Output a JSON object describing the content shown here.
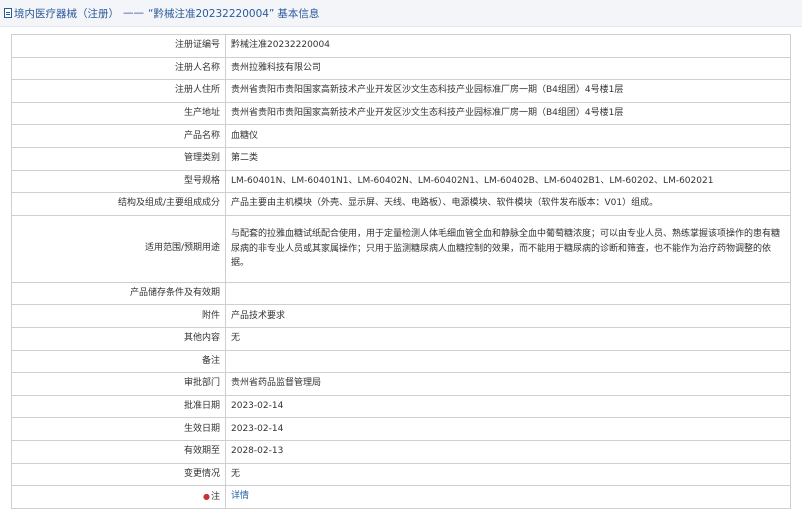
{
  "header": {
    "title": "境内医疗器械（注册）",
    "separator": "——",
    "subject": "“黔械注准20232220004”",
    "suffix": "基本信息"
  },
  "rows": [
    {
      "label": "注册证编号",
      "value": "黔械注准20232220004"
    },
    {
      "label": "注册人名称",
      "value": "贵州拉雅科技有限公司"
    },
    {
      "label": "注册人住所",
      "value": "贵州省贵阳市贵阳国家高新技术产业开发区沙文生态科技产业园标准厂房一期（B4组团）4号楼1层"
    },
    {
      "label": "生产地址",
      "value": "贵州省贵阳市贵阳国家高新技术产业开发区沙文生态科技产业园标准厂房一期（B4组团）4号楼1层"
    },
    {
      "label": "产品名称",
      "value": "血糖仪"
    },
    {
      "label": "管理类别",
      "value": "第二类"
    },
    {
      "label": "型号规格",
      "value": "LM-60401N、LM-60401N1、LM-60402N、LM-60402N1、LM-60402B、LM-60402B1、LM-60202、LM-602021"
    },
    {
      "label": "结构及组成/主要组成成分",
      "value": "产品主要由主机模块（外壳、显示屏、天线、电路板）、电源模块、软件模块（软件发布版本：V01）组成。"
    },
    {
      "label": "适用范围/预期用途",
      "value": "与配套的拉雅血糖试纸配合使用，用于定量检测人体毛细血管全血和静脉全血中葡萄糖浓度；可以由专业人员、熟练掌握该项操作的患有糖尿病的非专业人员或其家属操作；只用于监测糖尿病人血糖控制的效果，而不能用于糖尿病的诊断和筛查，也不能作为治疗药物调整的依据。"
    },
    {
      "label": "产品储存条件及有效期",
      "value": ""
    },
    {
      "label": "附件",
      "value": "产品技术要求"
    },
    {
      "label": "其他内容",
      "value": "无"
    },
    {
      "label": "备注",
      "value": ""
    },
    {
      "label": "审批部门",
      "value": "贵州省药品监督管理局"
    },
    {
      "label": "批准日期",
      "value": "2023-02-14"
    },
    {
      "label": "生效日期",
      "value": "2023-02-14"
    },
    {
      "label": "有效期至",
      "value": "2028-02-13"
    },
    {
      "label": "变更情况",
      "value": "无"
    }
  ],
  "note_row": {
    "icon_text": "●",
    "label": "注",
    "link": "详情"
  }
}
